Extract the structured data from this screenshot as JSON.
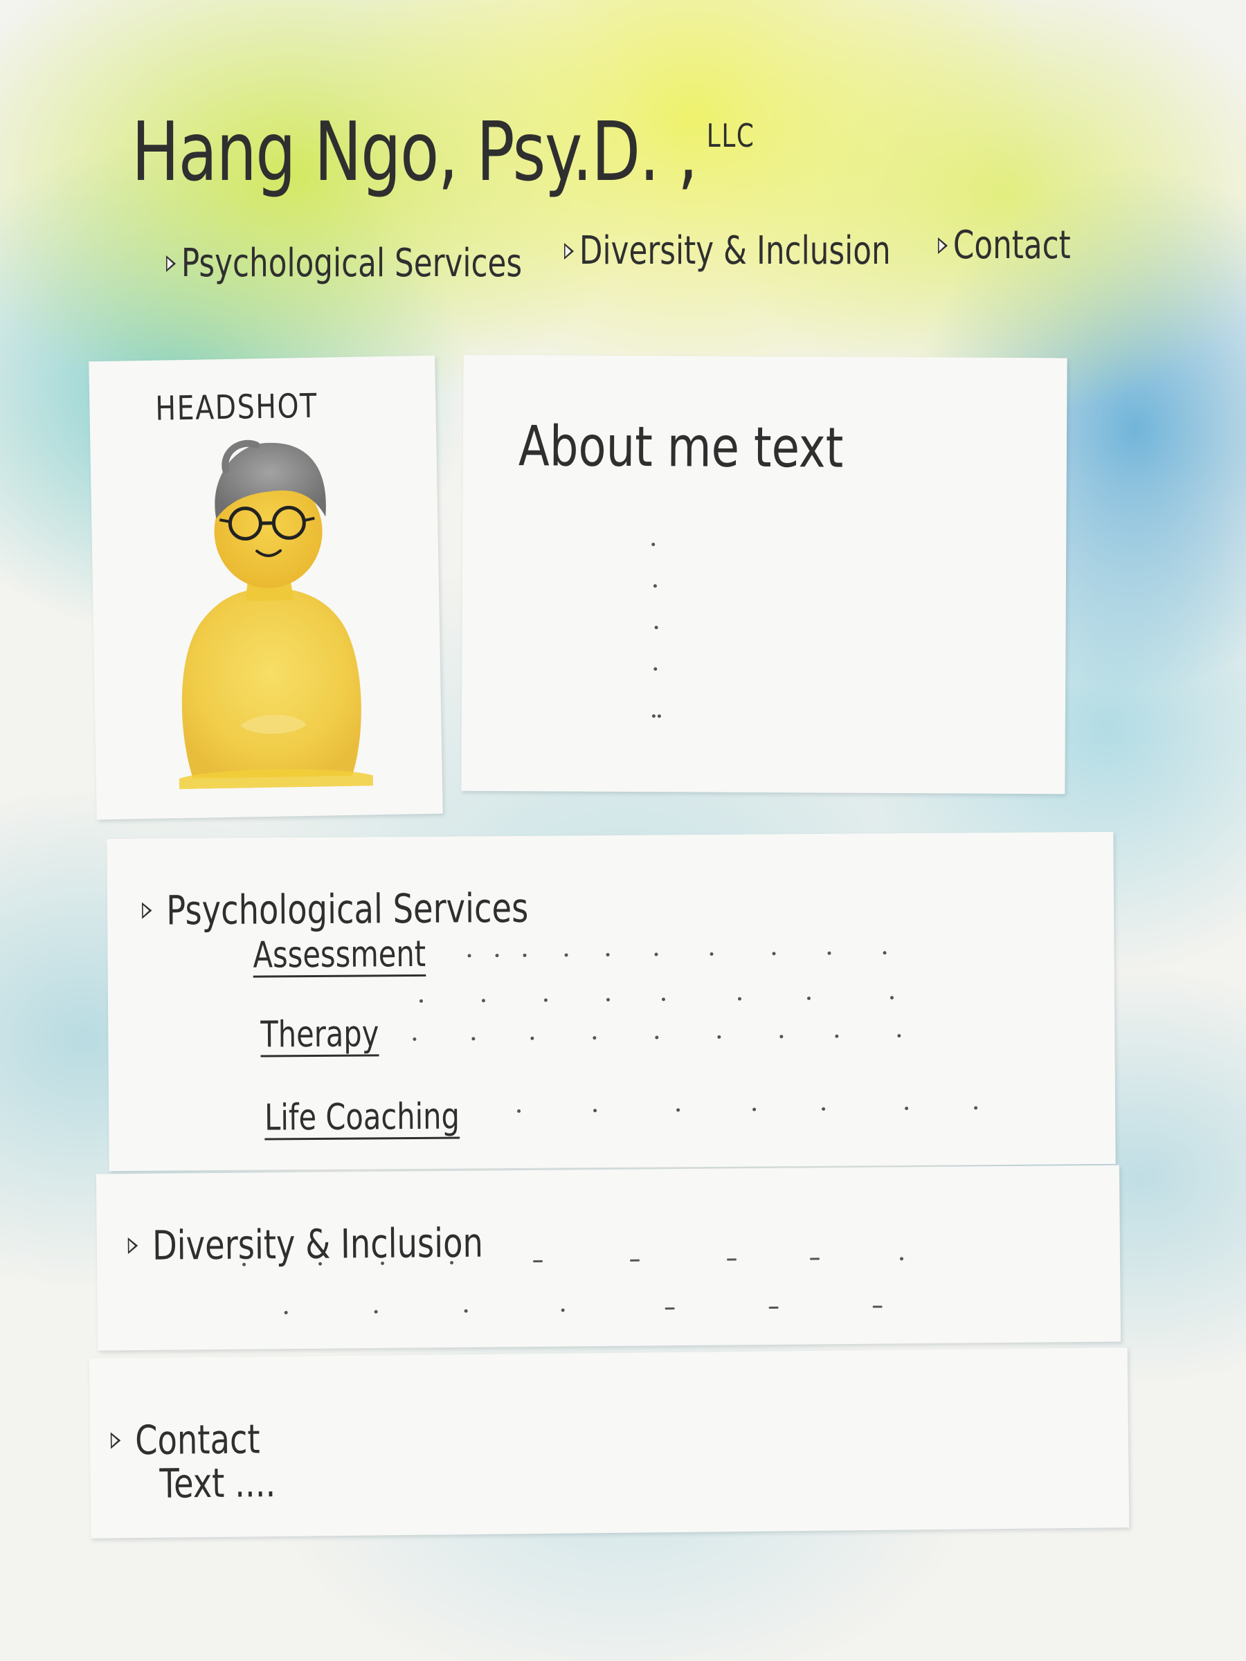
{
  "header": {
    "title": "Hang Ngo, Psy.D. ,",
    "title_suffix": "LLC"
  },
  "nav": {
    "items": [
      {
        "label": "Psychological Services"
      },
      {
        "label": "Diversity & Inclusion"
      },
      {
        "label": "Contact"
      }
    ]
  },
  "headshot": {
    "label": "HEADSHOT"
  },
  "about": {
    "title": "About me text"
  },
  "services": {
    "heading": "Psychological Services",
    "items": [
      {
        "label": "Assessment"
      },
      {
        "label": "Therapy"
      },
      {
        "label": "Life Coaching"
      }
    ]
  },
  "diversity": {
    "heading": "Diversity & Inclusion"
  },
  "contact": {
    "heading": "Contact",
    "text": "Text ...."
  },
  "colors": {
    "ink": "#2f2f2f",
    "paper": "#f8f8f6",
    "watercolor_yellow": "#eef264",
    "watercolor_blue": "#46a0d2",
    "watercolor_teal": "#6ec8c8",
    "figure_yellow": "#f2cf3a",
    "figure_hair": "#8a8a8a"
  }
}
